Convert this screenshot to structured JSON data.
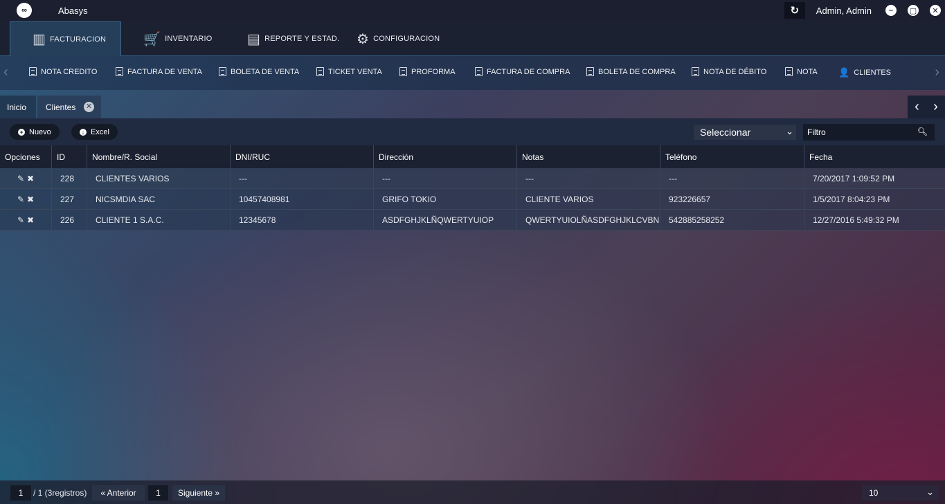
{
  "app": {
    "title": "Abasys",
    "user": "Admin, Admin"
  },
  "main_tabs": [
    {
      "label": "FACTURACION",
      "icon": "building-icon",
      "active": true
    },
    {
      "label": "INVENTARIO",
      "icon": "cart-icon"
    },
    {
      "label": "REPORTE Y ESTAD.",
      "icon": "report-icon"
    },
    {
      "label": "CONFIGURACION",
      "icon": "gear-icon"
    }
  ],
  "sub_nav": [
    "NOTA CREDITO",
    "FACTURA DE VENTA",
    "BOLETA DE VENTA",
    "TICKET VENTA",
    "PROFORMA",
    "FACTURA DE COMPRA",
    "BOLETA DE COMPRA",
    "NOTA DE DÉBITO",
    "NOTA",
    "CLIENTES"
  ],
  "page_tabs": [
    {
      "label": "Inicio"
    },
    {
      "label": "Clientes",
      "closable": true,
      "active": true
    }
  ],
  "toolbar": {
    "new_label": "Nuevo",
    "excel_label": "Excel",
    "select_value": "Seleccionar",
    "filter_placeholder": "Filtro"
  },
  "table": {
    "columns": [
      "Opciones",
      "ID",
      "Nombre/R. Social",
      "DNI/RUC",
      "Dirección",
      "Notas",
      "Teléfono",
      "Fecha"
    ],
    "rows": [
      [
        "228",
        "CLIENTES VARIOS",
        "---",
        "---",
        "---",
        "---",
        "7/20/2017 1:09:52 PM"
      ],
      [
        "227",
        "NICSMDIA SAC",
        "10457408981",
        "GRIFO TOKIO",
        "CLIENTE VARIOS",
        "923226657",
        "1/5/2017 8:04:23 PM"
      ],
      [
        "226",
        "CLIENTE 1 S.A.C.",
        "12345678",
        "ASDFGHJKLÑQWERTYUIOP",
        "QWERTYUIOLÑASDFGHJKLCVBNM,",
        "542885258252",
        "12/27/2016 5:49:32 PM"
      ]
    ]
  },
  "pager": {
    "current": "1",
    "total_text": "/ 1 (3registros)",
    "prev_label": "« Anterior",
    "page_button": "1",
    "next_label": "Siguiente »",
    "page_size": "10"
  }
}
